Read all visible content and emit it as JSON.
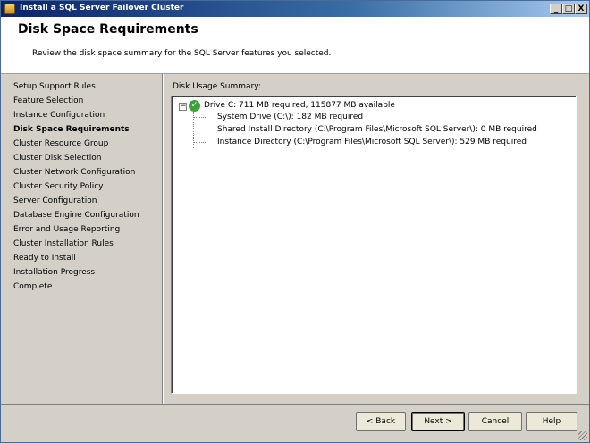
{
  "window": {
    "title": "Install a SQL Server Failover Cluster"
  },
  "window_controls": {
    "minimize": "_",
    "maximize": "□",
    "close": "X"
  },
  "header": {
    "title": "Disk Space Requirements",
    "subtitle": "Review the disk space summary for the SQL Server features you selected."
  },
  "nav": [
    {
      "label": "Setup Support Rules",
      "active": false
    },
    {
      "label": "Feature Selection",
      "active": false
    },
    {
      "label": "Instance Configuration",
      "active": false
    },
    {
      "label": "Disk Space Requirements",
      "active": true
    },
    {
      "label": "Cluster Resource Group",
      "active": false
    },
    {
      "label": "Cluster Disk Selection",
      "active": false
    },
    {
      "label": "Cluster Network Configuration",
      "active": false
    },
    {
      "label": "Cluster Security Policy",
      "active": false
    },
    {
      "label": "Server Configuration",
      "active": false
    },
    {
      "label": "Database Engine Configuration",
      "active": false
    },
    {
      "label": "Error and Usage Reporting",
      "active": false
    },
    {
      "label": "Cluster Installation Rules",
      "active": false
    },
    {
      "label": "Ready to Install",
      "active": false
    },
    {
      "label": "Installation Progress",
      "active": false
    },
    {
      "label": "Complete",
      "active": false
    }
  ],
  "summary": {
    "label": "Disk Usage Summary:",
    "expander": "−",
    "check": "✓",
    "drive": "Drive C: 711 MB required, 115877 MB available",
    "children": [
      "System Drive (C:\\): 182 MB required",
      "Shared Install Directory (C:\\Program Files\\Microsoft SQL Server\\): 0 MB required",
      "Instance Directory (C:\\Program Files\\Microsoft SQL Server\\): 529 MB required"
    ]
  },
  "buttons": {
    "back": "< Back",
    "next": "Next >",
    "cancel": "Cancel",
    "help": "Help"
  },
  "colors": {
    "accent": "#0a246a",
    "success": "#3aa33a"
  }
}
